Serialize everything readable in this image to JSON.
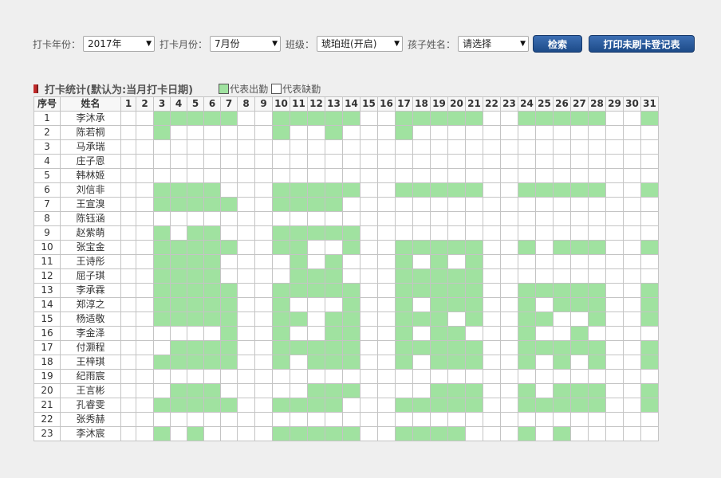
{
  "filters": {
    "year_label": "打卡年份：",
    "year_value": "2017年",
    "month_label": "打卡月份：",
    "month_value": "7月份",
    "class_label": "班级：",
    "class_value": "琥珀班(开启)",
    "child_label": "孩子姓名：",
    "child_value": "请选择",
    "search_button": "检索",
    "print_button": "打印未刷卡登记表"
  },
  "section": {
    "title": "打卡统计(默认为:当月打卡日期)",
    "legend_present": "代表出勤",
    "legend_absent": "代表缺勤",
    "marker_color": "#c12a2a",
    "present_color": "#a0e2a0"
  },
  "table": {
    "headers": {
      "index": "序号",
      "name": "姓名"
    },
    "days": [
      1,
      2,
      3,
      4,
      5,
      6,
      7,
      8,
      9,
      10,
      11,
      12,
      13,
      14,
      15,
      16,
      17,
      18,
      19,
      20,
      21,
      22,
      23,
      24,
      25,
      26,
      27,
      28,
      29,
      30,
      31
    ],
    "rows": [
      {
        "index": "1",
        "name": "李沐承",
        "present": [
          3,
          4,
          5,
          6,
          7,
          10,
          11,
          12,
          13,
          14,
          17,
          18,
          19,
          20,
          21,
          24,
          25,
          26,
          27,
          28,
          31
        ]
      },
      {
        "index": "2",
        "name": "陈若桐",
        "present": [
          3,
          10,
          13,
          17
        ]
      },
      {
        "index": "3",
        "name": "马承瑞",
        "present": []
      },
      {
        "index": "4",
        "name": "庄子恩",
        "present": []
      },
      {
        "index": "5",
        "name": "韩林姬",
        "present": []
      },
      {
        "index": "6",
        "name": "刘信非",
        "present": [
          3,
          4,
          5,
          6,
          10,
          11,
          12,
          13,
          14,
          17,
          18,
          19,
          20,
          21,
          24,
          25,
          26,
          27,
          28,
          31
        ]
      },
      {
        "index": "7",
        "name": "王宣溴",
        "present": [
          3,
          4,
          5,
          6,
          7,
          10,
          11,
          12,
          13
        ]
      },
      {
        "index": "8",
        "name": "陈钰涵",
        "present": []
      },
      {
        "index": "9",
        "name": "赵紫萌",
        "present": [
          3,
          5,
          6,
          10,
          11,
          12,
          13,
          14
        ]
      },
      {
        "index": "10",
        "name": "张宝金",
        "present": [
          3,
          4,
          5,
          6,
          7,
          10,
          11,
          14,
          17,
          18,
          19,
          20,
          21,
          24,
          26,
          27,
          28,
          31
        ]
      },
      {
        "index": "11",
        "name": "王诗彤",
        "present": [
          3,
          4,
          5,
          6,
          11,
          13,
          17,
          19,
          21
        ]
      },
      {
        "index": "12",
        "name": "屈子琪",
        "present": [
          3,
          4,
          5,
          6,
          11,
          12,
          13,
          17,
          18,
          19,
          20,
          21
        ]
      },
      {
        "index": "13",
        "name": "李承霖",
        "present": [
          3,
          4,
          5,
          6,
          7,
          10,
          11,
          12,
          13,
          14,
          17,
          18,
          19,
          20,
          21,
          24,
          25,
          26,
          27,
          28,
          31
        ]
      },
      {
        "index": "14",
        "name": "郑淳之",
        "present": [
          3,
          4,
          5,
          6,
          7,
          10,
          14,
          17,
          19,
          20,
          21,
          24,
          26,
          27,
          28,
          31
        ]
      },
      {
        "index": "15",
        "name": "杨适敬",
        "present": [
          3,
          4,
          5,
          6,
          7,
          10,
          11,
          13,
          14,
          17,
          18,
          19,
          21,
          24,
          25,
          28,
          31
        ]
      },
      {
        "index": "16",
        "name": "李金泽",
        "present": [
          7,
          10,
          13,
          14,
          17,
          19,
          20,
          24,
          27
        ]
      },
      {
        "index": "17",
        "name": "付灏程",
        "present": [
          4,
          5,
          6,
          7,
          10,
          11,
          12,
          13,
          14,
          17,
          18,
          19,
          20,
          21,
          24,
          25,
          26,
          27,
          28,
          31
        ]
      },
      {
        "index": "18",
        "name": "王梓琪",
        "present": [
          3,
          4,
          5,
          6,
          7,
          10,
          12,
          13,
          14,
          17,
          19,
          20,
          21,
          24,
          26,
          28,
          31
        ]
      },
      {
        "index": "19",
        "name": "纪雨宸",
        "present": []
      },
      {
        "index": "20",
        "name": "王言彬",
        "present": [
          4,
          5,
          6,
          12,
          13,
          14,
          19,
          20,
          21,
          24,
          26,
          27,
          28,
          31
        ]
      },
      {
        "index": "21",
        "name": "孔睿雯",
        "present": [
          3,
          4,
          5,
          6,
          7,
          10,
          11,
          12,
          13,
          17,
          18,
          19,
          20,
          21,
          24,
          25,
          26,
          27,
          28,
          31
        ]
      },
      {
        "index": "22",
        "name": "张秀赫",
        "present": []
      },
      {
        "index": "23",
        "name": "李沐宸",
        "present": [
          3,
          5,
          10,
          11,
          12,
          13,
          14,
          17,
          18,
          19,
          20,
          24,
          26
        ]
      }
    ]
  }
}
